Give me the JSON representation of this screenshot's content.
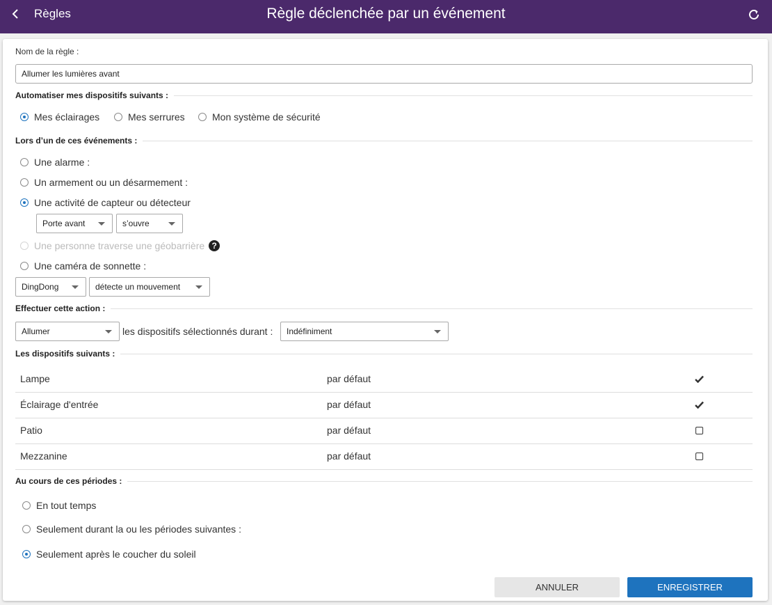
{
  "header": {
    "back_label": "Règles",
    "title": "Règle déclenchée par un événement"
  },
  "form": {
    "name_label": "Nom de la règle :",
    "name_value": "Allumer les lumières avant",
    "automate_section": "Automatiser mes dispositifs suivants :",
    "device_types": [
      "Mes éclairages",
      "Mes serrures",
      "Mon système de sécurité"
    ],
    "events_section": "Lors d’un de ces événements :",
    "events": {
      "alarm": "Une alarme :",
      "arming": "Un armement ou un désarmement :",
      "sensor": "Une activité de capteur ou détecteur",
      "geofence": "Une personne traverse une géobarrière",
      "doorbell": "Une caméra de sonnette :"
    },
    "sensor_select": "Porte avant",
    "sensor_action_select": "s’ouvre",
    "doorbell_select": "DingDong",
    "doorbell_action_select": "détecte un mouvement",
    "action_section": "Effectuer cette action :",
    "action_select": "Allumer",
    "action_mid_text": "les dispositifs sélectionnés durant :",
    "duration_select": "Indéfiniment",
    "devices_section": "Les dispositifs suivants :",
    "devices": [
      {
        "name": "Lampe",
        "mode": "par défaut",
        "checked": true
      },
      {
        "name": "Éclairage d'entrée",
        "mode": "par défaut",
        "checked": true
      },
      {
        "name": "Patio",
        "mode": "par défaut",
        "checked": false
      },
      {
        "name": "Mezzanine",
        "mode": "par défaut",
        "checked": false
      }
    ],
    "periods_section": "Au cours de ces périodes :",
    "periods": [
      "En tout temps",
      "Seulement durant la ou les périodes suivantes :",
      "Seulement après le coucher du soleil"
    ]
  },
  "buttons": {
    "cancel": "ANNULER",
    "save": "ENREGISTRER"
  },
  "colors": {
    "header_bg": "#4b296b",
    "accent": "#1e73be",
    "cancel_bg": "#e6e6e6"
  },
  "icons": {
    "back": "chevron-left-icon",
    "refresh": "refresh-icon",
    "help": "help-icon",
    "check": "checkmark-icon",
    "dropdown": "caret-down-icon"
  }
}
